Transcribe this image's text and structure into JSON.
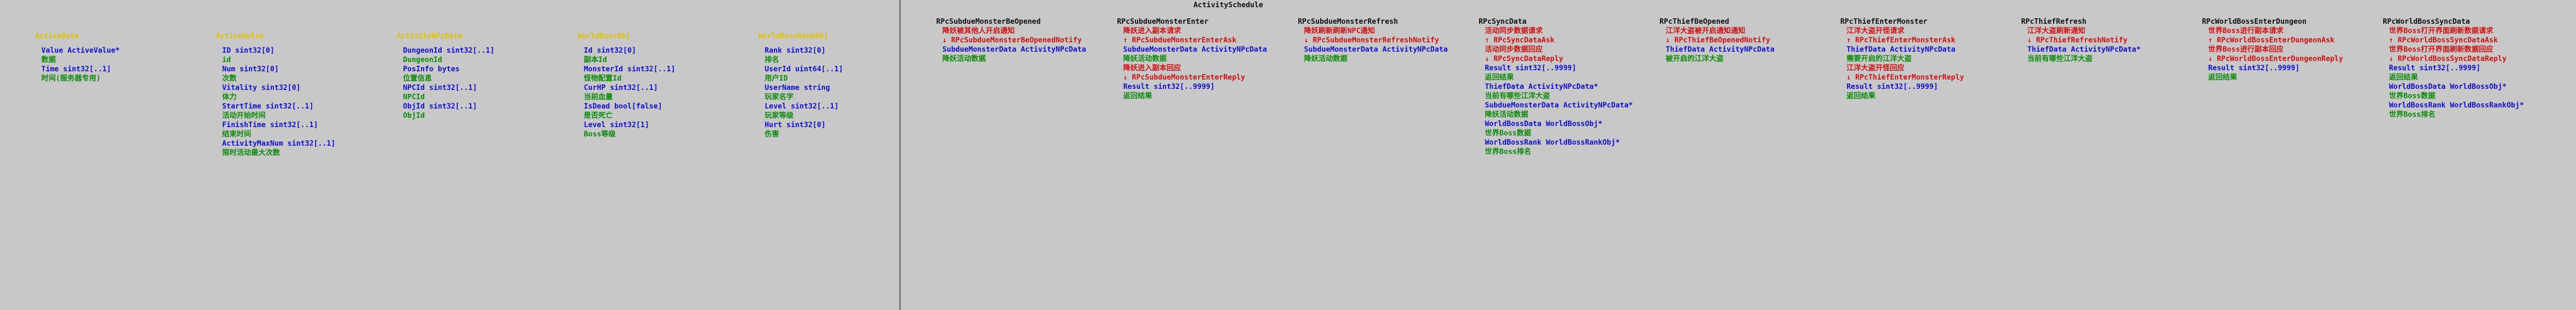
{
  "top_title": "ActivitySchedule",
  "left_columns": [
    {
      "title": "ActiveData",
      "lines": [
        {
          "text": "Value ActiveValue*",
          "color": "blue"
        },
        {
          "text": "数据",
          "color": "green"
        },
        {
          "text": "Time sint32[..1]",
          "color": "blue"
        },
        {
          "text": "时间(服务器专用)",
          "color": "green"
        }
      ]
    },
    {
      "title": "ActiveValue",
      "lines": [
        {
          "text": "ID sint32[0]",
          "color": "blue"
        },
        {
          "text": "id",
          "color": "green"
        },
        {
          "text": "Num sint32[0]",
          "color": "blue"
        },
        {
          "text": "次数",
          "color": "green"
        },
        {
          "text": "Vitality sint32[0]",
          "color": "blue"
        },
        {
          "text": "体力",
          "color": "green"
        },
        {
          "text": "StartTime sint32[..1]",
          "color": "blue"
        },
        {
          "text": "活动开始时间",
          "color": "green"
        },
        {
          "text": "FinishTime sint32[..1]",
          "color": "blue"
        },
        {
          "text": "结束时间",
          "color": "green"
        },
        {
          "text": "ActivityMaxNum sint32[..1]",
          "color": "blue"
        },
        {
          "text": "限时活动最大次数",
          "color": "green"
        }
      ]
    },
    {
      "title": "ActivityNPcData",
      "lines": [
        {
          "text": "DungeonId sint32[..1]",
          "color": "blue"
        },
        {
          "text": "DungeonId",
          "color": "green"
        },
        {
          "text": "PosInfo bytes",
          "color": "blue"
        },
        {
          "text": "位置信息",
          "color": "green"
        },
        {
          "text": "NPCId sint32[..1]",
          "color": "blue"
        },
        {
          "text": "NPCId",
          "color": "green"
        },
        {
          "text": "ObjId sint32[..1]",
          "color": "blue"
        },
        {
          "text": "ObjId",
          "color": "green"
        }
      ]
    },
    {
      "title": "WorldBossObj",
      "lines": [
        {
          "text": "Id sint32[0]",
          "color": "blue"
        },
        {
          "text": "副本Id",
          "color": "green"
        },
        {
          "text": "MonsterId sint32[..1]",
          "color": "blue"
        },
        {
          "text": "怪物配置Id",
          "color": "green"
        },
        {
          "text": "CurHP sint32[..1]",
          "color": "blue"
        },
        {
          "text": "当前血量",
          "color": "green"
        },
        {
          "text": "IsDead bool[false]",
          "color": "blue"
        },
        {
          "text": "是否死亡",
          "color": "green"
        },
        {
          "text": "Level sint32[1]",
          "color": "blue"
        },
        {
          "text": "Boss等级",
          "color": "green"
        }
      ]
    },
    {
      "title": "WorldBossRankObj",
      "lines": [
        {
          "text": "Rank sint32[0]",
          "color": "blue"
        },
        {
          "text": "排名",
          "color": "green"
        },
        {
          "text": "UserId uint64[..1]",
          "color": "blue"
        },
        {
          "text": "用户ID",
          "color": "green"
        },
        {
          "text": "UserName string",
          "color": "blue"
        },
        {
          "text": "玩家名字",
          "color": "green"
        },
        {
          "text": "Level sint32[..1]",
          "color": "blue"
        },
        {
          "text": "玩家等级",
          "color": "green"
        },
        {
          "text": "Hurt sint32[0]",
          "color": "blue"
        },
        {
          "text": "伤害",
          "color": "green"
        }
      ]
    }
  ],
  "right_columns": [
    {
      "title": "RPcSubdueMonsterBeOpened",
      "lines": [
        {
          "text": "降妖被其他人开启通知",
          "color": "red"
        },
        {
          "text": "↓ RPcSubdueMonsterBeOpenedNotify",
          "color": "red"
        },
        {
          "text": "SubdueMonsterData ActivityNPcData",
          "color": "blue"
        },
        {
          "text": "降妖活动数据",
          "color": "green"
        }
      ]
    },
    {
      "title": "RPcSubdueMonsterEnter",
      "lines": [
        {
          "text": "降妖进入副本请求",
          "color": "red"
        },
        {
          "text": "↑ RPcSubdueMonsterEnterAsk",
          "color": "red"
        },
        {
          "text": "SubdueMonsterData ActivityNPcData",
          "color": "blue"
        },
        {
          "text": "降妖活动数据",
          "color": "green"
        },
        {
          "text": "降妖进入副本回应",
          "color": "red"
        },
        {
          "text": "↓ RPcSubdueMonsterEnterReply",
          "color": "red"
        },
        {
          "text": "Result sint32[..9999]",
          "color": "blue"
        },
        {
          "text": "返回结果",
          "color": "green"
        }
      ]
    },
    {
      "title": "RPcSubdueMonsterRefresh",
      "lines": [
        {
          "text": "降妖刷新刷新NPC通知",
          "color": "red"
        },
        {
          "text": "↓ RPcSubdueMonsterRefreshNotify",
          "color": "red"
        },
        {
          "text": "SubdueMonsterData ActivityNPcData",
          "color": "blue"
        },
        {
          "text": "降妖活动数据",
          "color": "green"
        }
      ]
    },
    {
      "title": "RPcSyncData",
      "lines": [
        {
          "text": "活动同步数据请求",
          "color": "red"
        },
        {
          "text": "↑ RPcSyncDataAsk",
          "color": "red"
        },
        {
          "text": "活动同步数据回应",
          "color": "red"
        },
        {
          "text": "↓ RPcSyncDataReply",
          "color": "red"
        },
        {
          "text": "Result sint32[..9999]",
          "color": "blue"
        },
        {
          "text": "返回结果",
          "color": "green"
        },
        {
          "text": "ThiefData ActivityNPcData*",
          "color": "blue"
        },
        {
          "text": "当前有哪些江洋大盗",
          "color": "green"
        },
        {
          "text": "SubdueMonsterData ActivityNPcData*",
          "color": "blue"
        },
        {
          "text": "降妖活动数据",
          "color": "green"
        },
        {
          "text": "WorldBossData WorldBossObj*",
          "color": "blue"
        },
        {
          "text": "世界Boss数据",
          "color": "green"
        },
        {
          "text": "WorldBossRank WorldBossRankObj*",
          "color": "blue"
        },
        {
          "text": "世界Boss排名",
          "color": "green"
        }
      ]
    },
    {
      "title": "RPcThiefBeOpened",
      "lines": [
        {
          "text": "江洋大盗被开启通知通知",
          "color": "red"
        },
        {
          "text": "↓ RPcThiefBeOpenedNotify",
          "color": "red"
        },
        {
          "text": "ThiefData ActivityNPcData",
          "color": "blue"
        },
        {
          "text": "被开启的江洋大盗",
          "color": "green"
        }
      ]
    },
    {
      "title": "RPcThiefEnterMonster",
      "lines": [
        {
          "text": "江洋大盗开怪请求",
          "color": "red"
        },
        {
          "text": "↑ RPcThiefEnterMonsterAsk",
          "color": "red"
        },
        {
          "text": "ThiefData ActivityNPcData",
          "color": "blue"
        },
        {
          "text": "需要开启的江洋大盗",
          "color": "green"
        },
        {
          "text": "江洋大盗开怪回应",
          "color": "red"
        },
        {
          "text": "↓ RPcThiefEnterMonsterReply",
          "color": "red"
        },
        {
          "text": "Result sint32[..9999]",
          "color": "blue"
        },
        {
          "text": "返回结果",
          "color": "green"
        }
      ]
    },
    {
      "title": "RPcThiefRefresh",
      "lines": [
        {
          "text": "江洋大盗刷新通知",
          "color": "red"
        },
        {
          "text": "↓ RPcThiefRefreshNotify",
          "color": "red"
        },
        {
          "text": "ThiefData ActivityNPcData*",
          "color": "blue"
        },
        {
          "text": "当前有哪些江洋大盗",
          "color": "green"
        }
      ]
    },
    {
      "title": "RPcWorldBossEnterDungeon",
      "lines": [
        {
          "text": "世界Boss进行副本请求",
          "color": "red"
        },
        {
          "text": "↑ RPcWorldBossEnterDungeonAsk",
          "color": "red"
        },
        {
          "text": "世界Boss进行副本回应",
          "color": "red"
        },
        {
          "text": "↓ RPcWorldBossEnterDungeonReply",
          "color": "red"
        },
        {
          "text": "Result sint32[..9999]",
          "color": "blue"
        },
        {
          "text": "返回结果",
          "color": "green"
        }
      ]
    },
    {
      "title": "RPcWorldBossSyncData",
      "lines": [
        {
          "text": "世界Boss打开界面刷新数据请求",
          "color": "red"
        },
        {
          "text": "↑ RPcWorldBossSyncDataAsk",
          "color": "red"
        },
        {
          "text": "世界Boss打开界面刷新数据回应",
          "color": "red"
        },
        {
          "text": "↓ RPcWorldBossSyncDataReply",
          "color": "red"
        },
        {
          "text": "Result sint32[..9999]",
          "color": "blue"
        },
        {
          "text": "返回结果",
          "color": "green"
        },
        {
          "text": "WorldBossData WorldBossObj*",
          "color": "blue"
        },
        {
          "text": "世界Boss数据",
          "color": "green"
        },
        {
          "text": "WorldBossRank WorldBossRankObj*",
          "color": "blue"
        },
        {
          "text": "世界Boss排名",
          "color": "green"
        }
      ]
    }
  ],
  "colors": {
    "background": "#c8c8c8",
    "title_yellow": "#e0c000",
    "field_blue": "#1010d0",
    "comment_green": "#0a8a0a",
    "message_red": "#d01010",
    "title_dark": "#111111"
  }
}
